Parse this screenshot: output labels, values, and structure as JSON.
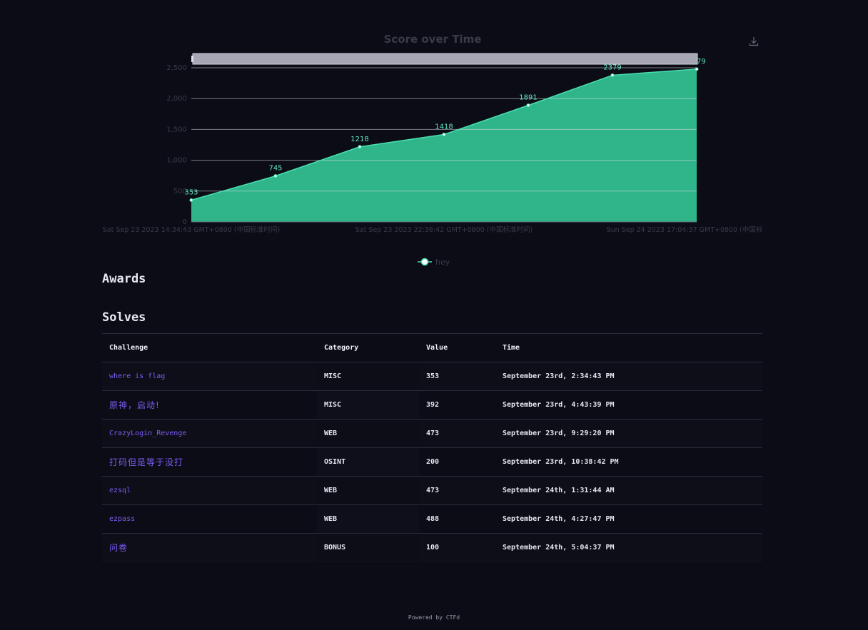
{
  "chart": {
    "title": "Score over Time",
    "legend_label": "hey",
    "colors": {
      "area": "#34c496",
      "line": "#48e0b0",
      "label": "#5fe8bf",
      "axis_text": "#3a3a48",
      "grid": "#d8d8e0",
      "slider": "#a6a6b4"
    }
  },
  "chart_data": {
    "type": "area",
    "title": "Score over Time",
    "x": [
      "Sat Sep 23 2023 14:34:43 GMT+0800 (中国标准时间)",
      "Sat Sep 23 2023 16:43:39 GMT+0800 (中国标准时间)",
      "Sat Sep 23 2023 21:29:20 GMT+0800 (中国标准时间)",
      "Sat Sep 23 2023 22:38:42 GMT+0800 (中国标准时间)",
      "Sun Sep 24 2023 01:31:44 GMT+0800 (中国标准时间)",
      "Sun Sep 24 2023 04:27:47 GMT+0800 (中国标准时间)",
      "Sun Sep 24 2023 17:04:37 GMT+0800 (中国标准时间)"
    ],
    "x_tick_labels": [
      "Sat Sep 23 2023 14:34:43 GMT+0800 (中国标准时间)",
      "Sat Sep 23 2023 22:38:42 GMT+0800 (中国标准时间)",
      "Sun Sep 24 2023 17:04:37 GMT+0800 (中国标"
    ],
    "y_tick_labels": [
      "0",
      "500",
      "1,000",
      "1,500",
      "2,000",
      "2,500"
    ],
    "series": [
      {
        "name": "hey",
        "values": [
          353,
          745,
          1218,
          1418,
          1891,
          2379,
          2479
        ]
      }
    ],
    "ylim": [
      0,
      2500
    ],
    "grid": true,
    "legend": "bottom-center"
  },
  "awards_heading": "Awards",
  "solves_heading": "Solves",
  "table": {
    "headers": [
      "Challenge",
      "Category",
      "Value",
      "Time"
    ],
    "rows": [
      {
        "challenge": "where is flag",
        "category": "MISC",
        "value": "353",
        "time": "September 23rd, 2:34:43 PM"
      },
      {
        "challenge": "原神，启动!",
        "category": "MISC",
        "value": "392",
        "time": "September 23rd, 4:43:39 PM"
      },
      {
        "challenge": "CrazyLogin_Revenge",
        "category": "WEB",
        "value": "473",
        "time": "September 23rd, 9:29:20 PM"
      },
      {
        "challenge": "打码但是等于没打",
        "category": "OSINT",
        "value": "200",
        "time": "September 23rd, 10:38:42 PM"
      },
      {
        "challenge": "ezsql",
        "category": "WEB",
        "value": "473",
        "time": "September 24th, 1:31:44 AM"
      },
      {
        "challenge": "ezpass",
        "category": "WEB",
        "value": "488",
        "time": "September 24th, 4:27:47 PM"
      },
      {
        "challenge": "问卷",
        "category": "BONUS",
        "value": "100",
        "time": "September 24th, 5:04:37 PM"
      }
    ]
  },
  "footer": "Powered by CTFd"
}
